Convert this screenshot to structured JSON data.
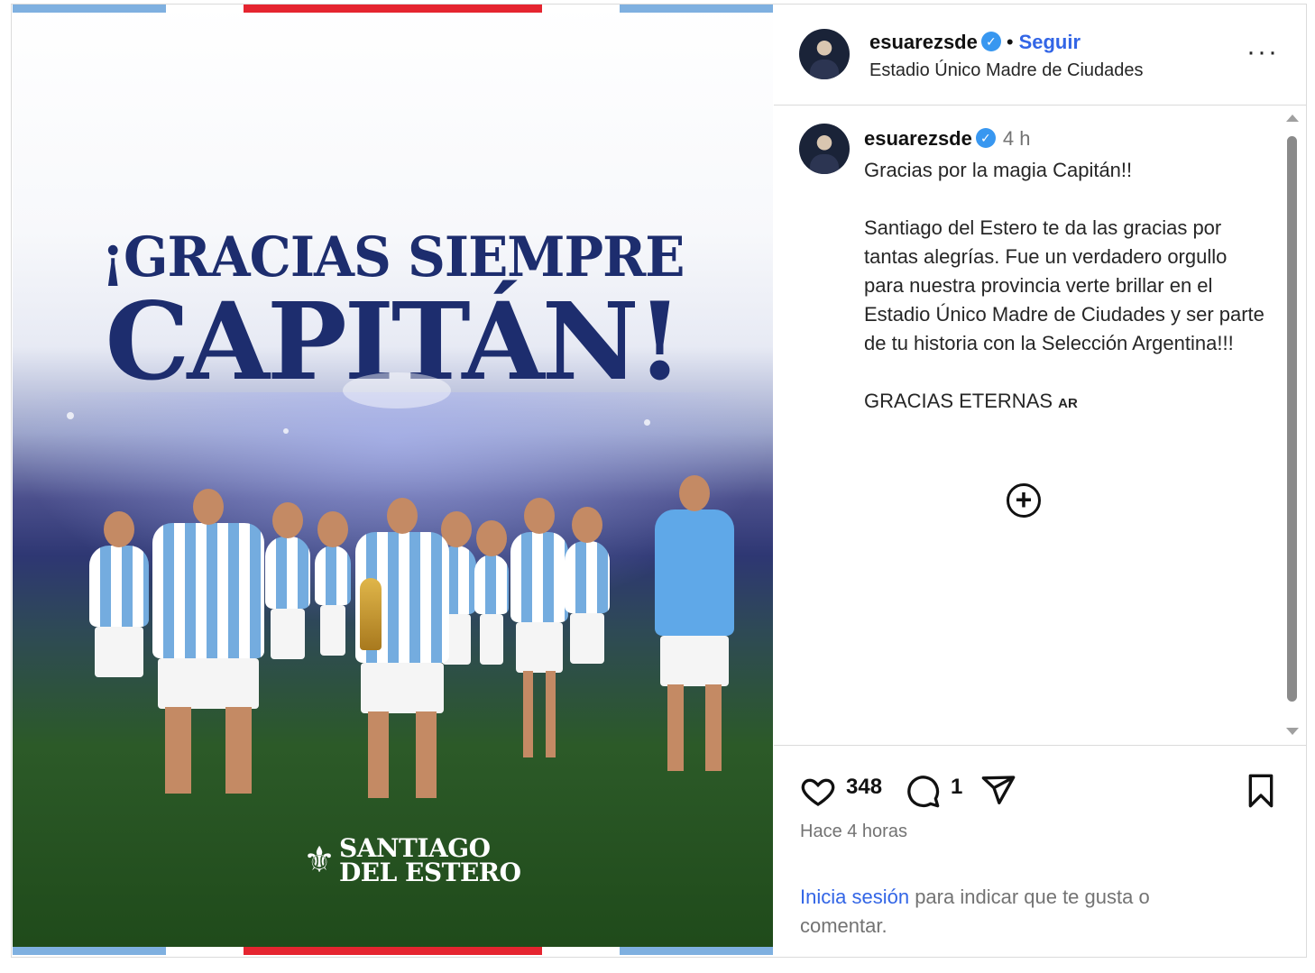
{
  "post": {
    "image": {
      "headline_line1": "¡GRACIAS SIEMPRE",
      "headline_line2": "CAPITÁN!",
      "logo_line1": "SANTIAGO",
      "logo_line2": "DEL ESTERO",
      "colors": {
        "navy": "#1d2d6e",
        "celeste": "#7fb0e0",
        "red": "#e52530"
      }
    },
    "header": {
      "username": "esuarezsde",
      "separator": "•",
      "follow_label": "Seguir",
      "location": "Estadio Único Madre de Ciudades",
      "more_icon": "···"
    },
    "caption": {
      "username": "esuarezsde",
      "time_ago": "4 h",
      "text": "Gracias por la magia Capitán!!\n\nSantiago del Estero te da las gracias por tantas alegrías. Fue un verdadero orgullo para nuestra provincia verte brillar en el Estadio Único Madre de Ciudades y ser parte de tu historia con la Selección Argentina!!!\n\nGRACIAS ETERNAS ",
      "flag_text": "AR",
      "more_comments_icon": "+"
    },
    "actions": {
      "likes": "348",
      "comments": "1",
      "posted": "Hace 4 horas",
      "login_link": "Inicia sesión",
      "login_rest": " para indicar que te gusta o comentar."
    },
    "icons": {
      "verified": "✓",
      "accent_blue": "#3265e6"
    }
  }
}
